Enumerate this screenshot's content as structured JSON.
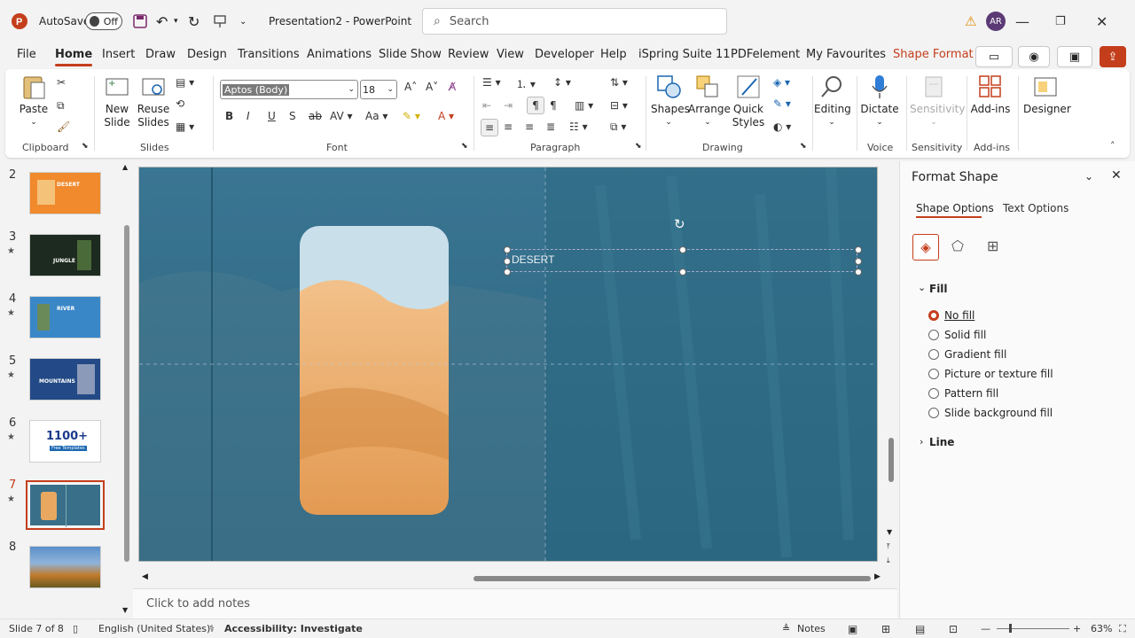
{
  "titlebar": {
    "autosave_label": "AutoSave",
    "autosave_state": "Off",
    "doc_title": "Presentation2  -  PowerPoint",
    "search_placeholder": "Search",
    "avatar_initials": "AR"
  },
  "menu": {
    "items": [
      "File",
      "Home",
      "Insert",
      "Draw",
      "Design",
      "Transitions",
      "Animations",
      "Slide Show",
      "Review",
      "View",
      "Developer",
      "Help",
      "iSpring Suite 11",
      "PDFelement",
      "My Favourites",
      "Shape Format"
    ]
  },
  "ribbon": {
    "clipboard": {
      "label": "Clipboard",
      "paste": "Paste"
    },
    "slides": {
      "label": "Slides",
      "new_slide": "New Slide",
      "reuse_slides": "Reuse Slides"
    },
    "font": {
      "label": "Font",
      "font_name": "Aptos (Body)",
      "font_size": "18"
    },
    "paragraph": {
      "label": "Paragraph"
    },
    "drawing": {
      "label": "Drawing",
      "shapes": "Shapes",
      "arrange": "Arrange",
      "quick_styles": "Quick Styles"
    },
    "editing": {
      "label": "Editing"
    },
    "voice": {
      "label": "Voice",
      "dictate": "Dictate"
    },
    "sensitivity": {
      "label": "Sensitivity",
      "button": "Sensitivity"
    },
    "addins": {
      "label": "Add-ins",
      "button": "Add-ins"
    },
    "designer": {
      "button": "Designer"
    }
  },
  "thumbnails": [
    {
      "num": "2",
      "starred": false,
      "title": "DESERT",
      "bg": "#f08a2c"
    },
    {
      "num": "3",
      "starred": true,
      "title": "JUNGLE",
      "bg": "#1d2a1f"
    },
    {
      "num": "4",
      "starred": true,
      "title": "RIVER",
      "bg": "#3a87c8"
    },
    {
      "num": "5",
      "starred": true,
      "title": "MOUNTAINS",
      "bg": "#234a86"
    },
    {
      "num": "6",
      "starred": true,
      "title": "1100+",
      "subtitle": "Free Templates",
      "bg": "#ffffff"
    },
    {
      "num": "7",
      "starred": true,
      "title": "",
      "bg": "#3a6f8a",
      "selected": true
    },
    {
      "num": "8",
      "starred": false,
      "title": "",
      "bg": "#5a8fc9"
    }
  ],
  "slide": {
    "textbox_text": "DESERT"
  },
  "notes_placeholder": "Click to add notes",
  "format_pane": {
    "title": "Format Shape",
    "tab_shape": "Shape Options",
    "tab_text": "Text Options",
    "fill_header": "Fill",
    "fill_options": [
      "No fill",
      "Solid fill",
      "Gradient fill",
      "Picture or texture fill",
      "Pattern fill",
      "Slide background fill"
    ],
    "selected_fill": "No fill",
    "line_header": "Line"
  },
  "status": {
    "slide_info": "Slide 7 of 8",
    "language": "English (United States)",
    "accessibility": "Accessibility: Investigate",
    "notes": "Notes",
    "zoom": "63%"
  },
  "colors": {
    "accent": "#c43e1c",
    "slide_bg": "#2f6986"
  }
}
